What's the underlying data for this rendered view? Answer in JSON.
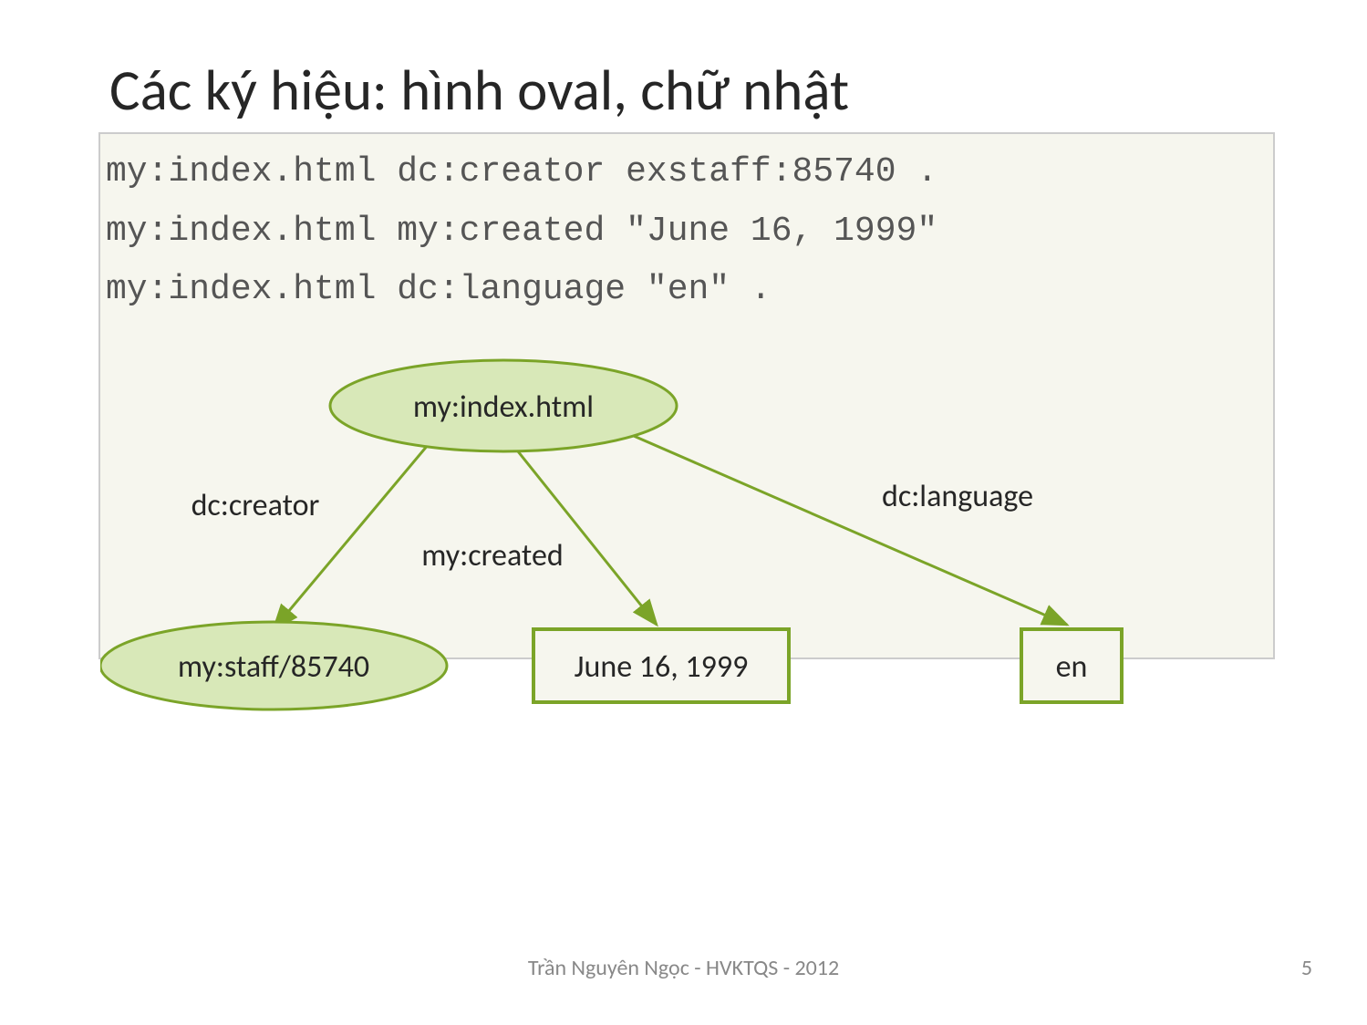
{
  "title": "Các ký hiệu: hình oval, chữ nhật",
  "code": {
    "line1": "my:index.html dc:creator exstaff:85740 .",
    "line2": "my:index.html my:created \"June 16, 1999\"",
    "line3": "my:index.html dc:language \"en\" ."
  },
  "diagram": {
    "root_node": "my:index.html",
    "edge1_label": "dc:creator",
    "edge2_label": "my:created",
    "edge3_label": "dc:language",
    "leaf1_node": "my:staff/85740",
    "leaf2_literal": "June 16, 1999",
    "leaf3_literal": "en",
    "colors": {
      "fill": "#d8e8b8",
      "stroke": "#7ba428",
      "rect_fill": "#f6f6ee"
    }
  },
  "footer": "Trần Nguyên Ngọc - HVKTQS - 2012",
  "page_number": "5"
}
